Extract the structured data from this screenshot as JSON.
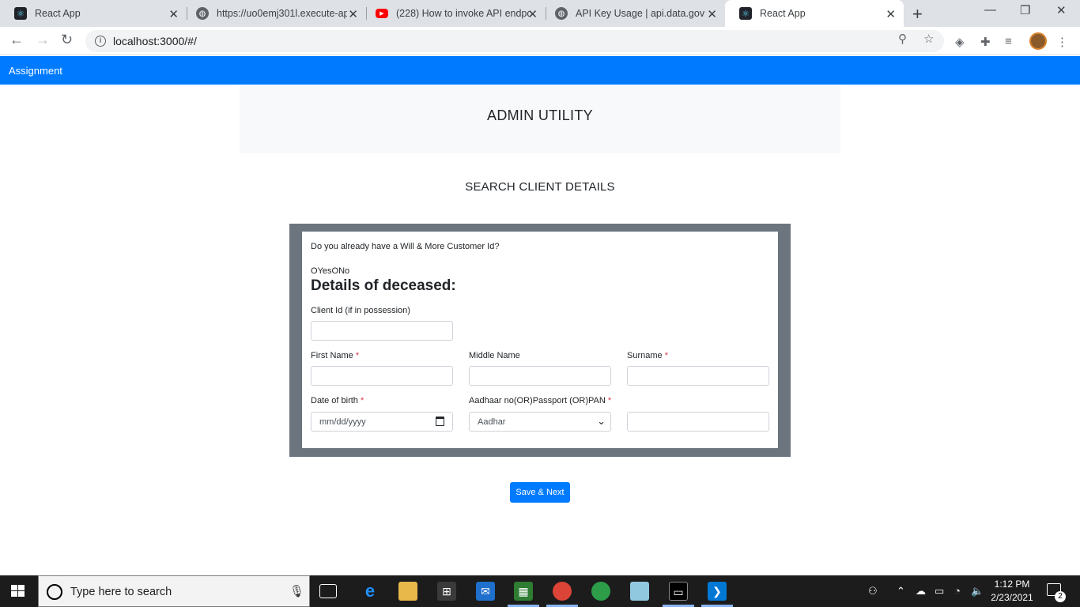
{
  "browser": {
    "tabs": [
      {
        "title": "React App",
        "favicon": "react-icon"
      },
      {
        "title": "https://uo0emj301l.execute-ap",
        "favicon": "globe-icon"
      },
      {
        "title": "(228) How to invoke API endpo",
        "favicon": "youtube-icon"
      },
      {
        "title": "API Key Usage | api.data.gov",
        "favicon": "globe-icon"
      },
      {
        "title": "React App",
        "favicon": "react-icon",
        "active": true
      }
    ],
    "url": "localhost:3000/#/"
  },
  "navbar": {
    "brand": "Assignment",
    "color": "#007bff"
  },
  "page": {
    "title": "ADMIN UTILITY",
    "subtitle": "SEARCH CLIENT DETAILS"
  },
  "form": {
    "question": "Do you already have a Will & More Customer Id?",
    "radio_yes": "Yes",
    "radio_no": "No",
    "section_title": "Details of deceased:",
    "client_id_label": "Client Id (if in possession)",
    "first_name_label": "First Name",
    "middle_name_label": "Middle Name",
    "surname_label": "Surname",
    "dob_label": "Date of birth",
    "dob_placeholder": "mm/dd/yyyy",
    "id_type_label": "Aadhaar no(OR)Passport (OR)PAN",
    "id_type_selected": "Aadhar",
    "required_marker": "*",
    "save_button": "Save & Next"
  },
  "taskbar": {
    "search_placeholder": "Type here to search",
    "time": "1:12 PM",
    "date": "2/23/2021",
    "notification_count": "2"
  }
}
